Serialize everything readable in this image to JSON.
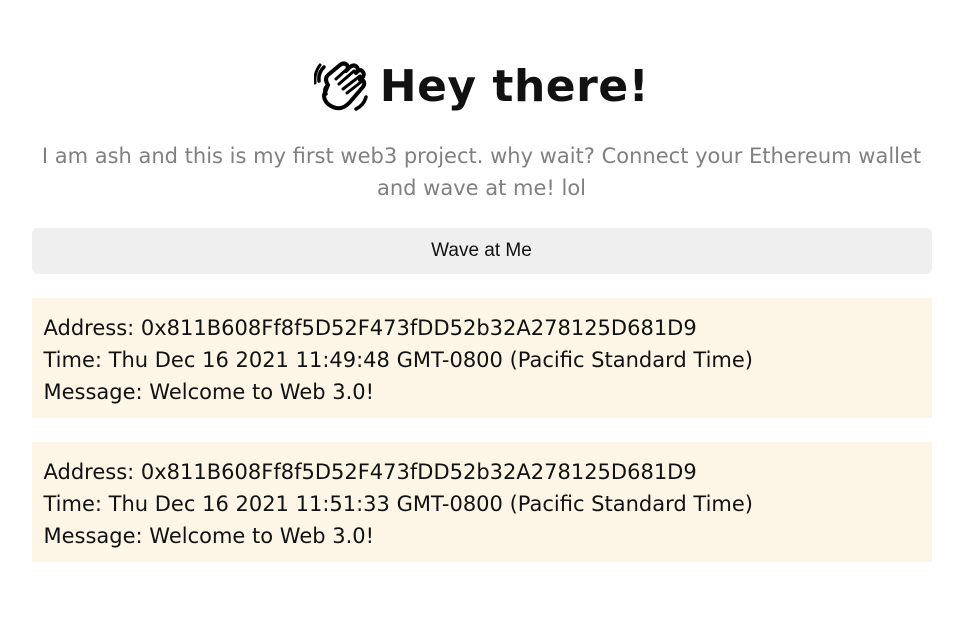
{
  "header": {
    "emoji": "waving-hand-icon",
    "title": "Hey there!"
  },
  "bio": "I am ash and this is my first web3 project. why wait? Connect your Ethereum wallet and wave at me! lol",
  "wave_button": {
    "label": "Wave at Me"
  },
  "waves": [
    {
      "address_label": "Address: 0x811B608Ff8f5D52F473fDD52b32A278125D681D9",
      "time_label": "Time: Thu Dec 16 2021 11:49:48 GMT-0800 (Pacific Standard Time)",
      "message_label": "Message: Welcome to Web 3.0!"
    },
    {
      "address_label": "Address: 0x811B608Ff8f5D52F473fDD52b32A278125D681D9",
      "time_label": "Time: Thu Dec 16 2021 11:51:33 GMT-0800 (Pacific Standard Time)",
      "message_label": "Message: Welcome to Web 3.0!"
    }
  ],
  "colors": {
    "card_background": "#fdf5e6",
    "button_background": "#efefef",
    "bio_text": "#808080"
  }
}
